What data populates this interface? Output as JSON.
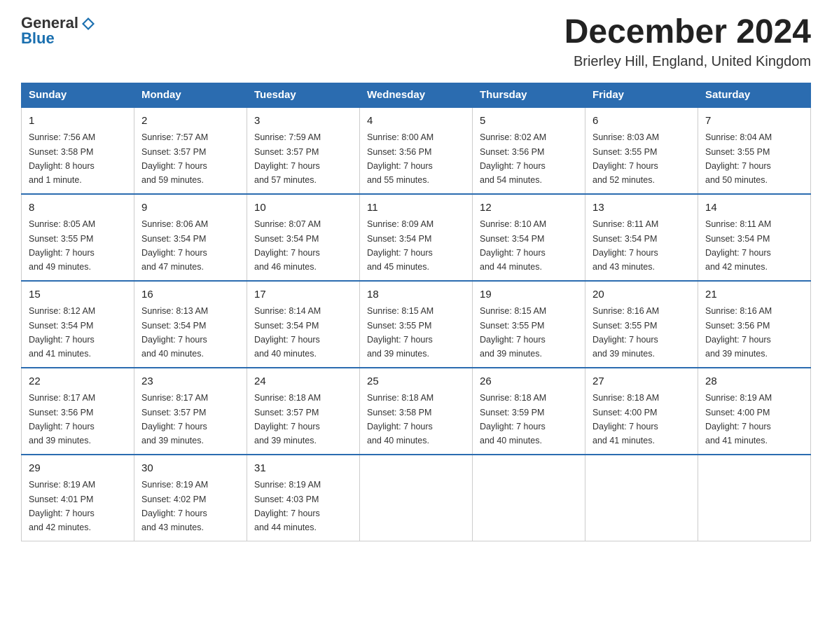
{
  "header": {
    "logo_general": "General",
    "logo_blue": "Blue",
    "month_title": "December 2024",
    "location": "Brierley Hill, England, United Kingdom"
  },
  "weekdays": [
    "Sunday",
    "Monday",
    "Tuesday",
    "Wednesday",
    "Thursday",
    "Friday",
    "Saturday"
  ],
  "weeks": [
    [
      {
        "day": "1",
        "sunrise": "7:56 AM",
        "sunset": "3:58 PM",
        "daylight": "8 hours and 1 minute."
      },
      {
        "day": "2",
        "sunrise": "7:57 AM",
        "sunset": "3:57 PM",
        "daylight": "7 hours and 59 minutes."
      },
      {
        "day": "3",
        "sunrise": "7:59 AM",
        "sunset": "3:57 PM",
        "daylight": "7 hours and 57 minutes."
      },
      {
        "day": "4",
        "sunrise": "8:00 AM",
        "sunset": "3:56 PM",
        "daylight": "7 hours and 55 minutes."
      },
      {
        "day": "5",
        "sunrise": "8:02 AM",
        "sunset": "3:56 PM",
        "daylight": "7 hours and 54 minutes."
      },
      {
        "day": "6",
        "sunrise": "8:03 AM",
        "sunset": "3:55 PM",
        "daylight": "7 hours and 52 minutes."
      },
      {
        "day": "7",
        "sunrise": "8:04 AM",
        "sunset": "3:55 PM",
        "daylight": "7 hours and 50 minutes."
      }
    ],
    [
      {
        "day": "8",
        "sunrise": "8:05 AM",
        "sunset": "3:55 PM",
        "daylight": "7 hours and 49 minutes."
      },
      {
        "day": "9",
        "sunrise": "8:06 AM",
        "sunset": "3:54 PM",
        "daylight": "7 hours and 47 minutes."
      },
      {
        "day": "10",
        "sunrise": "8:07 AM",
        "sunset": "3:54 PM",
        "daylight": "7 hours and 46 minutes."
      },
      {
        "day": "11",
        "sunrise": "8:09 AM",
        "sunset": "3:54 PM",
        "daylight": "7 hours and 45 minutes."
      },
      {
        "day": "12",
        "sunrise": "8:10 AM",
        "sunset": "3:54 PM",
        "daylight": "7 hours and 44 minutes."
      },
      {
        "day": "13",
        "sunrise": "8:11 AM",
        "sunset": "3:54 PM",
        "daylight": "7 hours and 43 minutes."
      },
      {
        "day": "14",
        "sunrise": "8:11 AM",
        "sunset": "3:54 PM",
        "daylight": "7 hours and 42 minutes."
      }
    ],
    [
      {
        "day": "15",
        "sunrise": "8:12 AM",
        "sunset": "3:54 PM",
        "daylight": "7 hours and 41 minutes."
      },
      {
        "day": "16",
        "sunrise": "8:13 AM",
        "sunset": "3:54 PM",
        "daylight": "7 hours and 40 minutes."
      },
      {
        "day": "17",
        "sunrise": "8:14 AM",
        "sunset": "3:54 PM",
        "daylight": "7 hours and 40 minutes."
      },
      {
        "day": "18",
        "sunrise": "8:15 AM",
        "sunset": "3:55 PM",
        "daylight": "7 hours and 39 minutes."
      },
      {
        "day": "19",
        "sunrise": "8:15 AM",
        "sunset": "3:55 PM",
        "daylight": "7 hours and 39 minutes."
      },
      {
        "day": "20",
        "sunrise": "8:16 AM",
        "sunset": "3:55 PM",
        "daylight": "7 hours and 39 minutes."
      },
      {
        "day": "21",
        "sunrise": "8:16 AM",
        "sunset": "3:56 PM",
        "daylight": "7 hours and 39 minutes."
      }
    ],
    [
      {
        "day": "22",
        "sunrise": "8:17 AM",
        "sunset": "3:56 PM",
        "daylight": "7 hours and 39 minutes."
      },
      {
        "day": "23",
        "sunrise": "8:17 AM",
        "sunset": "3:57 PM",
        "daylight": "7 hours and 39 minutes."
      },
      {
        "day": "24",
        "sunrise": "8:18 AM",
        "sunset": "3:57 PM",
        "daylight": "7 hours and 39 minutes."
      },
      {
        "day": "25",
        "sunrise": "8:18 AM",
        "sunset": "3:58 PM",
        "daylight": "7 hours and 40 minutes."
      },
      {
        "day": "26",
        "sunrise": "8:18 AM",
        "sunset": "3:59 PM",
        "daylight": "7 hours and 40 minutes."
      },
      {
        "day": "27",
        "sunrise": "8:18 AM",
        "sunset": "4:00 PM",
        "daylight": "7 hours and 41 minutes."
      },
      {
        "day": "28",
        "sunrise": "8:19 AM",
        "sunset": "4:00 PM",
        "daylight": "7 hours and 41 minutes."
      }
    ],
    [
      {
        "day": "29",
        "sunrise": "8:19 AM",
        "sunset": "4:01 PM",
        "daylight": "7 hours and 42 minutes."
      },
      {
        "day": "30",
        "sunrise": "8:19 AM",
        "sunset": "4:02 PM",
        "daylight": "7 hours and 43 minutes."
      },
      {
        "day": "31",
        "sunrise": "8:19 AM",
        "sunset": "4:03 PM",
        "daylight": "7 hours and 44 minutes."
      },
      null,
      null,
      null,
      null
    ]
  ],
  "labels": {
    "sunrise": "Sunrise:",
    "sunset": "Sunset:",
    "daylight": "Daylight:"
  }
}
